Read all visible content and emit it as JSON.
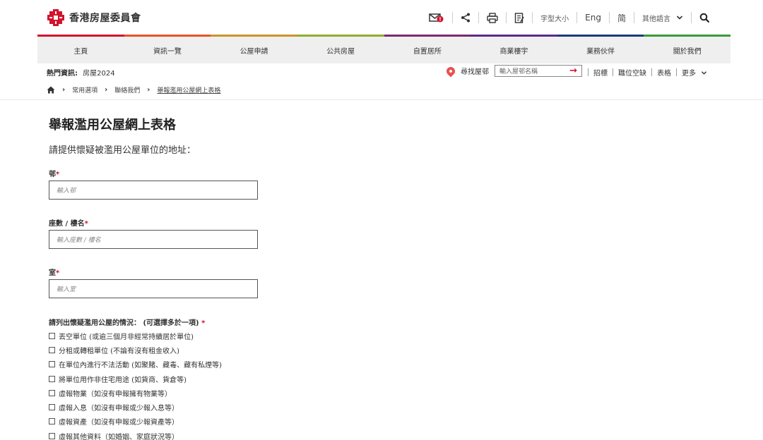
{
  "logo": {
    "text": "香港房屋委員會"
  },
  "header_tools": {
    "font_size_label": "字型大小",
    "lang_en": "Eng",
    "lang_sc": "简",
    "other_lang": "其他語言"
  },
  "strip_colors": [
    "#d0152d",
    "#e8512a",
    "#c8952a",
    "#8dad2d",
    "#7a2a6a",
    "#5a2a8a",
    "#1a3a7a",
    "#3a9a3a"
  ],
  "nav": {
    "items": [
      {
        "label": "主頁"
      },
      {
        "label": "資訊一覽"
      },
      {
        "label": "公屋申請"
      },
      {
        "label": "公共房屋"
      },
      {
        "label": "自置居所"
      },
      {
        "label": "商業樓宇"
      },
      {
        "label": "業務伙伴"
      },
      {
        "label": "關於我們"
      }
    ]
  },
  "hot": {
    "label": "熱門資訊:",
    "value": "房屋2024"
  },
  "estate_search": {
    "label": "尋找屋邨",
    "placeholder": "輸入屋邨名稱"
  },
  "quick_links": [
    {
      "label": "招標"
    },
    {
      "label": "職位空缺"
    },
    {
      "label": "表格"
    },
    {
      "label": "更多"
    }
  ],
  "breadcrumb": {
    "items": [
      {
        "label": "常用選項"
      },
      {
        "label": "聯絡我們"
      },
      {
        "label": "舉報濫用公屋網上表格"
      }
    ]
  },
  "form": {
    "title": "舉報濫用公屋網上表格",
    "subtitle": "請提供懷疑被濫用公屋單位的地址：",
    "fields": [
      {
        "label": "邨",
        "placeholder": "輸入邨"
      },
      {
        "label": "座數 / 樓名",
        "placeholder": "輸入座數 / 樓名"
      },
      {
        "label": "室",
        "placeholder": "輸入室"
      }
    ],
    "question": "請列出懷疑濫用公屋的情況： (可選擇多於一項)",
    "options": [
      {
        "label": "丟空單位 (或逾三個月非經常持續居於單位)"
      },
      {
        "label": "分租或轉租單位 (不論有沒有租金收入)"
      },
      {
        "label": "在單位內進行不法活動 (如聚賭、藏毒、藏有私煙等)"
      },
      {
        "label": "將單位用作非住宅用途 (如貨商、貨倉等)"
      },
      {
        "label": "虛報物業（如沒有申報擁有物業等）"
      },
      {
        "label": "虛報入息（如沒有申報或少報入息等）"
      },
      {
        "label": "虛報資產（如沒有申報或少報資產等）"
      },
      {
        "label": "虛報其他資料（如婚姻、家庭狀況等）"
      }
    ]
  }
}
